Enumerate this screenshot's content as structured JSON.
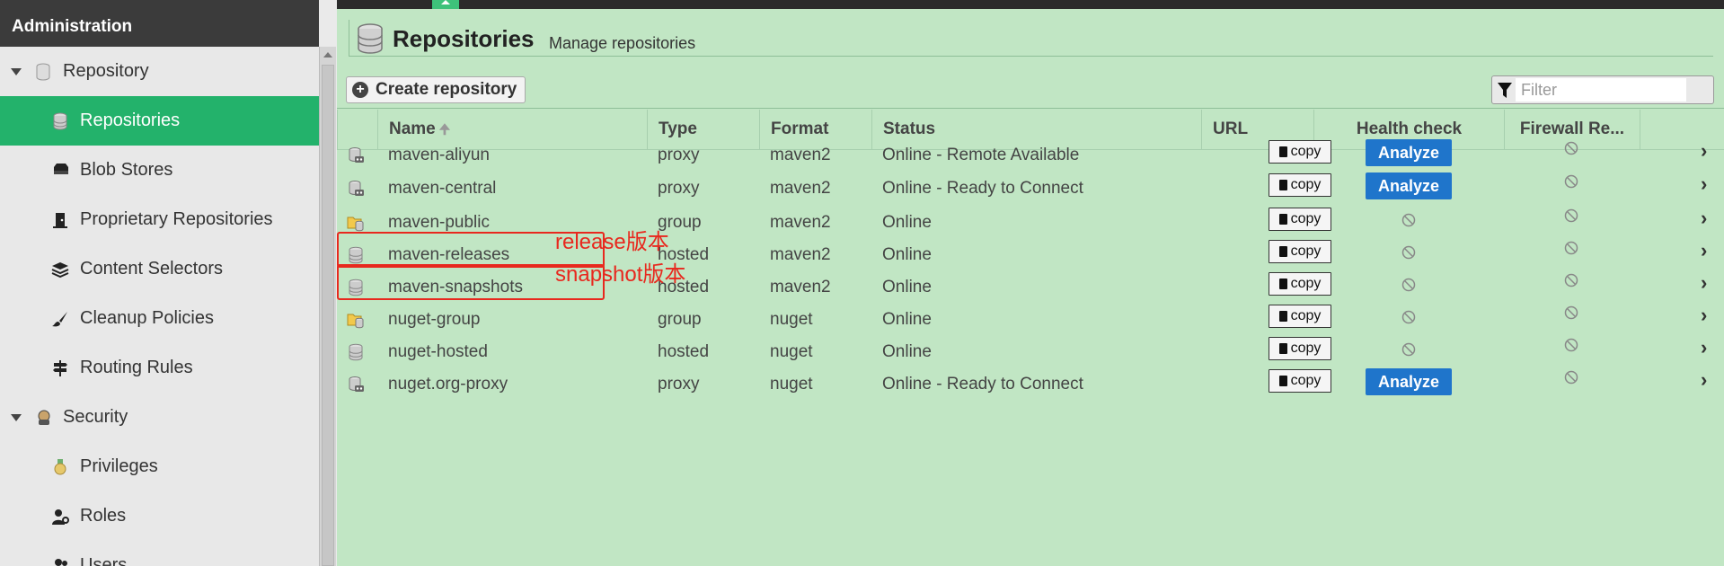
{
  "sidebar": {
    "header": "Administration",
    "items": [
      {
        "label": "Repository",
        "type": "group",
        "icon": "repository-icon"
      },
      {
        "label": "Repositories",
        "type": "child",
        "selected": true,
        "icon": "database-icon"
      },
      {
        "label": "Blob Stores",
        "type": "child",
        "icon": "blob-store-icon"
      },
      {
        "label": "Proprietary Repositories",
        "type": "child",
        "icon": "proprietary-icon"
      },
      {
        "label": "Content Selectors",
        "type": "child",
        "icon": "layers-icon"
      },
      {
        "label": "Cleanup Policies",
        "type": "child",
        "icon": "brush-icon"
      },
      {
        "label": "Routing Rules",
        "type": "child",
        "icon": "signpost-icon"
      },
      {
        "label": "Security",
        "type": "group",
        "icon": "security-icon"
      },
      {
        "label": "Privileges",
        "type": "child",
        "icon": "medal-icon"
      },
      {
        "label": "Roles",
        "type": "child",
        "icon": "roles-icon"
      },
      {
        "label": "Users",
        "type": "child",
        "icon": "users-icon"
      }
    ]
  },
  "page": {
    "title": "Repositories",
    "subtitle": "Manage repositories"
  },
  "toolbar": {
    "create_label": "Create repository",
    "filter_placeholder": "Filter"
  },
  "table": {
    "columns": {
      "name": "Name",
      "type": "Type",
      "format": "Format",
      "status": "Status",
      "url": "URL",
      "health": "Health check",
      "firewall": "Firewall Re..."
    },
    "copy_label": "copy",
    "analyze_label": "Analyze",
    "rows": [
      {
        "icon": "proxy",
        "name": "maven-aliyun",
        "type": "proxy",
        "format": "maven2",
        "status": "Online - Remote Available",
        "health": "analyze"
      },
      {
        "icon": "proxy",
        "name": "maven-central",
        "type": "proxy",
        "format": "maven2",
        "status": "Online - Ready to Connect",
        "health": "analyze"
      },
      {
        "icon": "group",
        "name": "maven-public",
        "type": "group",
        "format": "maven2",
        "status": "Online",
        "health": "none"
      },
      {
        "icon": "hosted",
        "name": "maven-releases",
        "type": "hosted",
        "format": "maven2",
        "status": "Online",
        "health": "none"
      },
      {
        "icon": "hosted",
        "name": "maven-snapshots",
        "type": "hosted",
        "format": "maven2",
        "status": "Online",
        "health": "none"
      },
      {
        "icon": "group",
        "name": "nuget-group",
        "type": "group",
        "format": "nuget",
        "status": "Online",
        "health": "none"
      },
      {
        "icon": "hosted",
        "name": "nuget-hosted",
        "type": "hosted",
        "format": "nuget",
        "status": "Online",
        "health": "none"
      },
      {
        "icon": "proxy",
        "name": "nuget.org-proxy",
        "type": "proxy",
        "format": "nuget",
        "status": "Online - Ready to Connect",
        "health": "analyze"
      }
    ]
  },
  "annotations": [
    {
      "row": 3,
      "text": "release版本"
    },
    {
      "row": 4,
      "text": "snapshot版本"
    }
  ],
  "colors": {
    "accent": "#23b26b",
    "main_bg": "#c1e6c4",
    "analyze_button": "#1f75cb",
    "annotation": "#e8281e",
    "header_dark": "#3b3b3b"
  }
}
